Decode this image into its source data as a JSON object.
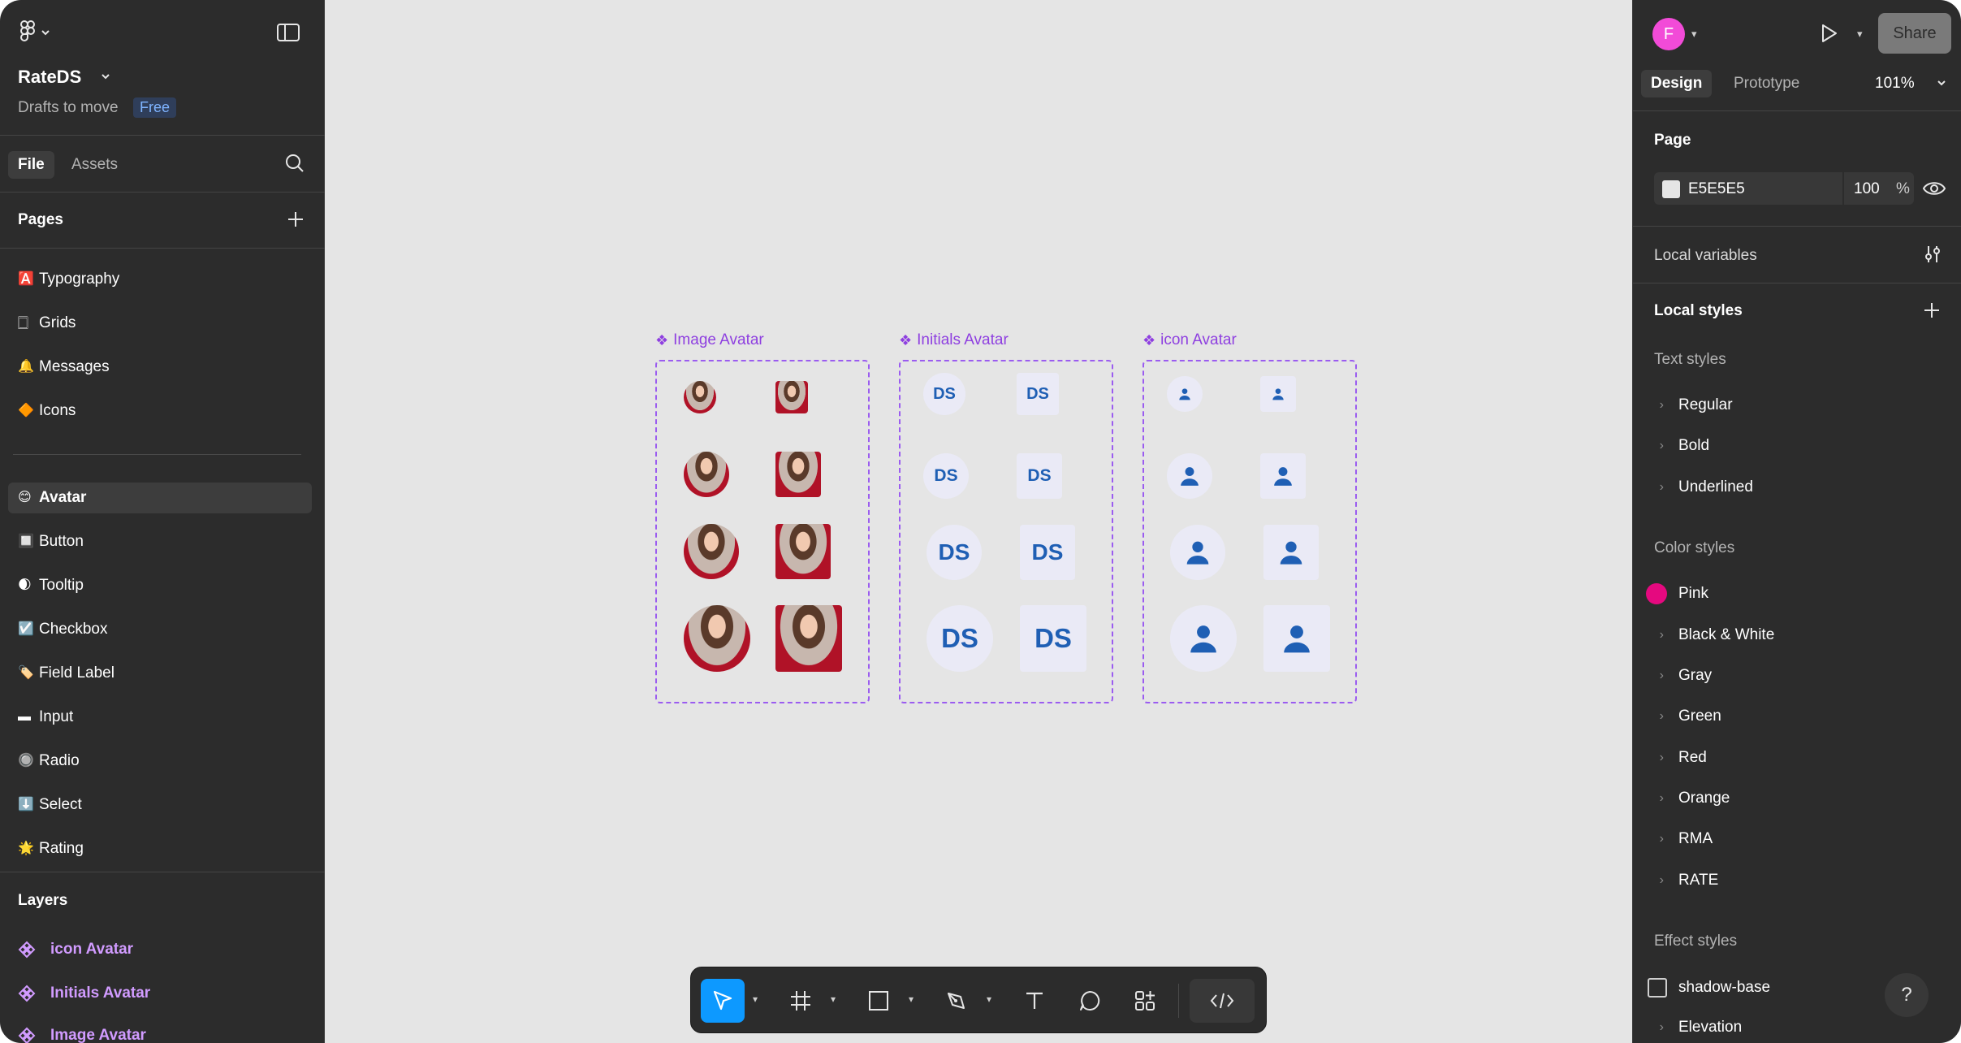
{
  "app": {
    "file_name": "RateDS",
    "location": "Drafts to move",
    "plan_badge": "Free"
  },
  "left_panel": {
    "tabs": {
      "file": "File",
      "assets": "Assets"
    },
    "pages_header": "Pages",
    "pages_group1": [
      {
        "emoji": "🅰️",
        "label": "Typography"
      },
      {
        "emoji": "🀆",
        "label": "Grids"
      },
      {
        "emoji": "🔔",
        "label": "Messages"
      },
      {
        "emoji": "🔶",
        "label": "Icons"
      }
    ],
    "pages_group2": [
      {
        "emoji": "😊",
        "label": "Avatar",
        "selected": true
      },
      {
        "emoji": "🔲",
        "label": "Button"
      },
      {
        "emoji": "🌒",
        "label": "Tooltip"
      },
      {
        "emoji": "☑️",
        "label": "Checkbox"
      },
      {
        "emoji": "🏷️",
        "label": "Field Label"
      },
      {
        "emoji": "▬",
        "label": "Input"
      },
      {
        "emoji": "🔘",
        "label": "Radio"
      },
      {
        "emoji": "⬇️",
        "label": "Select"
      },
      {
        "emoji": "🌟",
        "label": "Rating"
      }
    ],
    "layers_header": "Layers",
    "layers": [
      {
        "label": "icon Avatar"
      },
      {
        "label": "Initials Avatar"
      },
      {
        "label": "Image Avatar"
      }
    ]
  },
  "canvas": {
    "background": "#E5E5E5",
    "frame_titles": {
      "image": "Image Avatar",
      "initials": "Initials Avatar",
      "icon": "icon Avatar"
    },
    "initials_text": "DS"
  },
  "right_panel": {
    "user_initial": "F",
    "share_label": "Share",
    "tabs": {
      "design": "Design",
      "prototype": "Prototype"
    },
    "zoom": "101%",
    "page_section": "Page",
    "page_color_hex": "E5E5E5",
    "page_opacity": "100",
    "page_opacity_unit": "%",
    "local_variables": "Local variables",
    "local_styles": "Local styles",
    "text_styles_header": "Text styles",
    "text_styles": [
      "Regular",
      "Bold",
      "Underlined"
    ],
    "color_styles_header": "Color styles",
    "color_styles": [
      {
        "label": "Pink",
        "swatch": "#E5097F"
      },
      {
        "label": "Black & White"
      },
      {
        "label": "Gray"
      },
      {
        "label": "Green"
      },
      {
        "label": "Red"
      },
      {
        "label": "Orange"
      },
      {
        "label": "RMA"
      },
      {
        "label": "RATE"
      }
    ],
    "effect_styles_header": "Effect styles",
    "effect_styles": [
      "shadow-base",
      "Elevation"
    ],
    "help_label": "?"
  },
  "colors": {
    "panel_bg": "#2C2C2C",
    "accent_blue": "#0D99FF",
    "frame_purple": "#9B5CF0",
    "avatar_blue": "#1F5FB4",
    "avatar_tile": "#EAEAF6",
    "user_avatar_bg": "#F24BD8"
  }
}
